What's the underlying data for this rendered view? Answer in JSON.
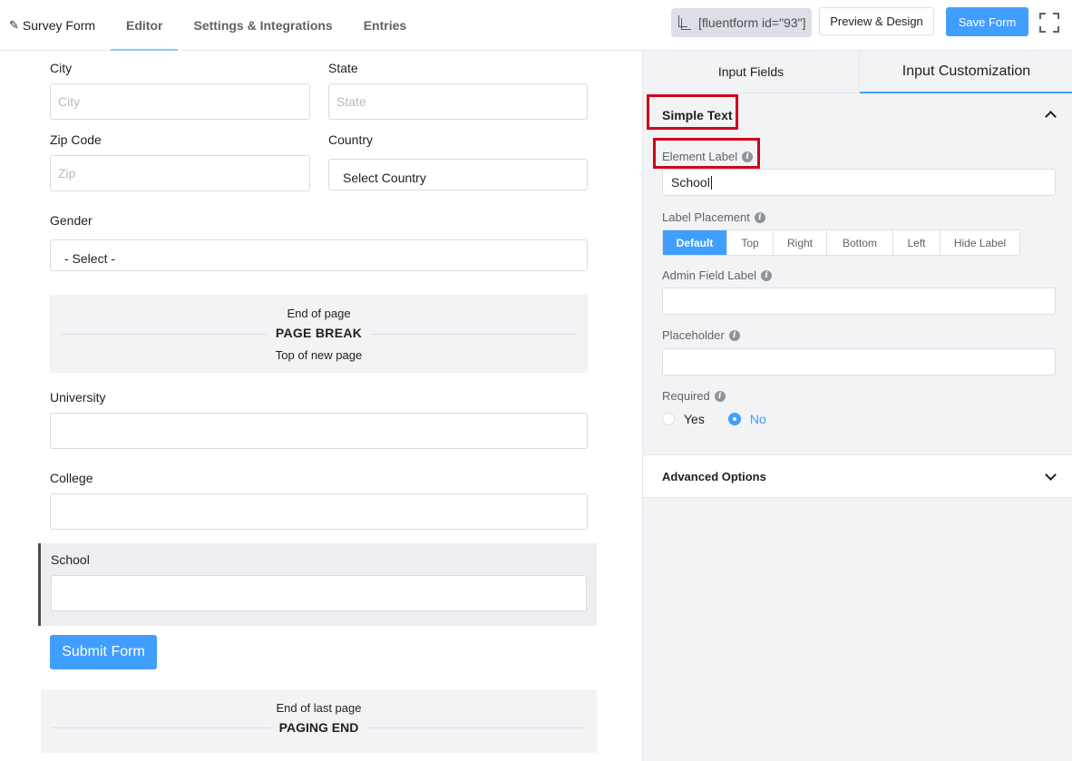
{
  "topbar": {
    "form_name": "Survey Form",
    "tabs": [
      "Editor",
      "Settings & Integrations",
      "Entries"
    ],
    "shortcode": "[fluentform id=\"93\"]",
    "preview_label": "Preview & Design",
    "save_label": "Save Form",
    "accent": "#409eff"
  },
  "editor": {
    "city": {
      "label": "City",
      "placeholder": "City"
    },
    "state": {
      "label": "State",
      "placeholder": "State"
    },
    "zip": {
      "label": "Zip Code",
      "placeholder": "Zip"
    },
    "country": {
      "label": "Country",
      "value": "Select Country"
    },
    "gender": {
      "label": "Gender",
      "value": "- Select -"
    },
    "page_break": {
      "top": "End of page",
      "title": "PAGE BREAK",
      "bottom": "Top of new page"
    },
    "university": {
      "label": "University"
    },
    "college": {
      "label": "College"
    },
    "school": {
      "label": "School"
    },
    "submit_label": "Submit Form",
    "paging_end": {
      "top": "End of last page",
      "title": "PAGING END"
    }
  },
  "sidebar": {
    "tabs": [
      "Input Fields",
      "Input Customization"
    ],
    "panel_title": "Simple Text",
    "element_label": {
      "label": "Element Label",
      "value": "School"
    },
    "label_placement": {
      "label": "Label Placement",
      "options": [
        "Default",
        "Top",
        "Right",
        "Bottom",
        "Left",
        "Hide Label"
      ],
      "selected": "Default"
    },
    "admin_field_label": {
      "label": "Admin Field Label",
      "value": ""
    },
    "placeholder": {
      "label": "Placeholder",
      "value": ""
    },
    "required": {
      "label": "Required",
      "options": [
        "Yes",
        "No"
      ],
      "selected": "No"
    },
    "advanced_options": "Advanced Options"
  }
}
